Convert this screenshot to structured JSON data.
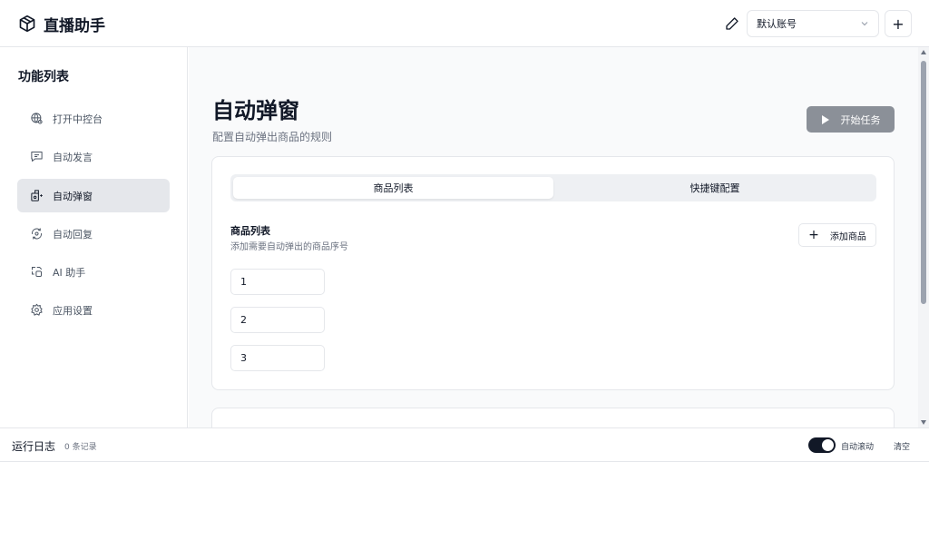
{
  "header": {
    "title": "直播助手",
    "account_select": "默认账号",
    "add_label": "+"
  },
  "sidebar": {
    "title": "功能列表",
    "items": [
      {
        "label": "打开中控台",
        "icon": "globe-icon"
      },
      {
        "label": "自动发言",
        "icon": "message-icon"
      },
      {
        "label": "自动弹窗",
        "icon": "popup-icon",
        "active": true
      },
      {
        "label": "自动回复",
        "icon": "refresh-reply-icon"
      },
      {
        "label": "AI 助手",
        "icon": "ai-assistant-icon"
      },
      {
        "label": "应用设置",
        "icon": "gear-icon"
      }
    ]
  },
  "main": {
    "title": "自动弹窗",
    "subtitle": "配置自动弹出商品的规则",
    "start_button": "开始任务",
    "tabs": [
      {
        "label": "商品列表",
        "active": true
      },
      {
        "label": "快捷键配置",
        "active": false
      }
    ],
    "section_title": "商品列表",
    "section_desc": "添加需要自动弹出的商品序号",
    "add_product": "添加商品",
    "products": [
      "1",
      "2",
      "3"
    ]
  },
  "log": {
    "title": "运行日志",
    "count": "0 条记录",
    "auto_scroll": "自动滚动",
    "auto_scroll_on": true,
    "clear": "清空"
  }
}
